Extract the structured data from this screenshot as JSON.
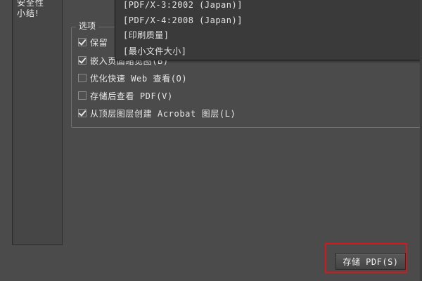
{
  "sidebar": {
    "items": [
      {
        "label": "安全性"
      },
      {
        "label": "小结!"
      }
    ]
  },
  "options": {
    "legend": "选项",
    "items": [
      {
        "label": "保留",
        "checked": true
      },
      {
        "label": "嵌入页面缩览图(B)",
        "checked": true
      },
      {
        "label": "优化快速 Web 查看(O)",
        "checked": false
      },
      {
        "label": "存储后查看 PDF(V)",
        "checked": false
      },
      {
        "label": "从顶层图层创建 Acrobat 图层(L)",
        "checked": true
      }
    ]
  },
  "preset_dropdown": {
    "items": [
      {
        "label": "[PDF/X-3:2002 (Japan)]"
      },
      {
        "label": "[PDF/X-4:2008 (Japan)]"
      },
      {
        "label": "[印刷质量]"
      },
      {
        "label": "[最小文件大小]"
      }
    ]
  },
  "footer": {
    "save_label": "存储 PDF(S)"
  },
  "colors": {
    "dialog_bg": "#4b4b4b",
    "dropdown_bg": "#3a3a3a",
    "highlight": "#d4191c"
  }
}
